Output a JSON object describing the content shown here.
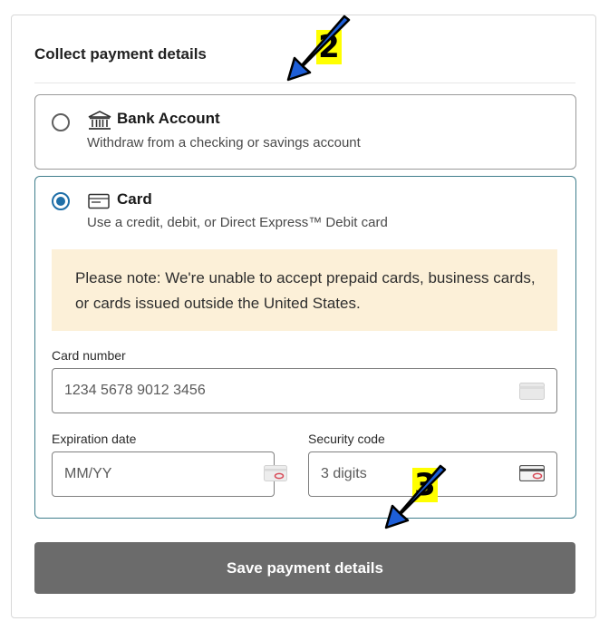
{
  "section_title": "Collect payment details",
  "options": {
    "bank": {
      "label": "Bank Account",
      "description": "Withdraw from a checking or savings account",
      "icon": "bank-icon",
      "selected": false
    },
    "card": {
      "label": "Card",
      "description": "Use a credit, debit, or Direct Express™ Debit card",
      "icon": "card-icon",
      "selected": true
    }
  },
  "notice_text": "Please note: We're unable to accept prepaid cards, business cards, or cards issued outside the United States.",
  "fields": {
    "card_number": {
      "label": "Card number",
      "placeholder": "1234 5678 9012 3456"
    },
    "expiration": {
      "label": "Expiration date",
      "placeholder": "MM/YY"
    },
    "security": {
      "label": "Security code",
      "placeholder": "3 digits"
    }
  },
  "save_button_label": "Save payment details",
  "annotations": {
    "marker_2": "2",
    "marker_3": "3"
  },
  "colors": {
    "selected_border": "#3f7e8c",
    "radio_selected": "#1f6fa8",
    "notice_background": "#fcf0d8",
    "button_background": "#6b6b6b",
    "marker_background": "#ffff00",
    "arrow_fill": "#1e5fd8"
  }
}
